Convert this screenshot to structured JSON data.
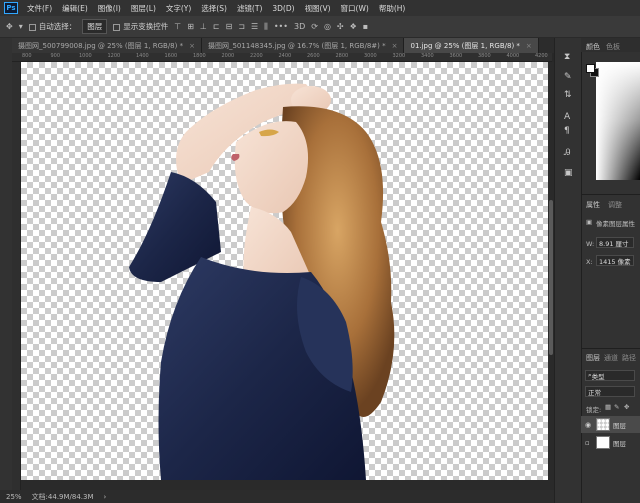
{
  "app": {
    "logo": "Ps"
  },
  "menu": [
    "文件(F)",
    "编辑(E)",
    "图像(I)",
    "图层(L)",
    "文字(Y)",
    "选择(S)",
    "滤镜(T)",
    "3D(D)",
    "视图(V)",
    "窗口(W)",
    "帮助(H)"
  ],
  "options": {
    "move_icon": "move-tool-icon",
    "auto_select_label": "自动选择：",
    "auto_select_value": "图层",
    "show_transform_label": "显示变换控件",
    "more_label": "•••"
  },
  "tabs": [
    {
      "label": "摄图网_500799008.jpg @ 25% (图层 1, RGB/8) *",
      "close": "×",
      "active": false
    },
    {
      "label": "摄图网_501148345.jpg @ 16.7% (图层 1, RGB/8#) *",
      "close": "×",
      "active": false
    },
    {
      "label": "01.jpg @ 25% (图层 1, RGB/8) *",
      "close": "×",
      "active": true
    }
  ],
  "ruler_ticks": [
    "800",
    "900",
    "1000",
    "1200",
    "1400",
    "1600",
    "1800",
    "2000",
    "2200",
    "2400",
    "2600",
    "2800",
    "3000",
    "3200",
    "3400",
    "3600",
    "3800",
    "4000",
    "4200"
  ],
  "status": {
    "zoom": "25%",
    "doc": "文档:44.9M/84.3M"
  },
  "panels": {
    "color_tab": "颜色",
    "swatches_tab": "色板",
    "properties_tab": "属性",
    "adjust_tab": "调整",
    "pixel_layer_label": "像素图层属性",
    "w_label": "W:",
    "w_value": "8.91 厘寸",
    "x_label": "X:",
    "x_value": "1415 像素",
    "layers_tab": "图层",
    "channels_tab": "通道",
    "paths_tab": "路径",
    "kind_label": "类型",
    "blend_mode": "正常",
    "lock_label": "锁定:",
    "layers": [
      {
        "name": "图层",
        "visible": true
      },
      {
        "name": "图层",
        "visible": false
      }
    ]
  }
}
